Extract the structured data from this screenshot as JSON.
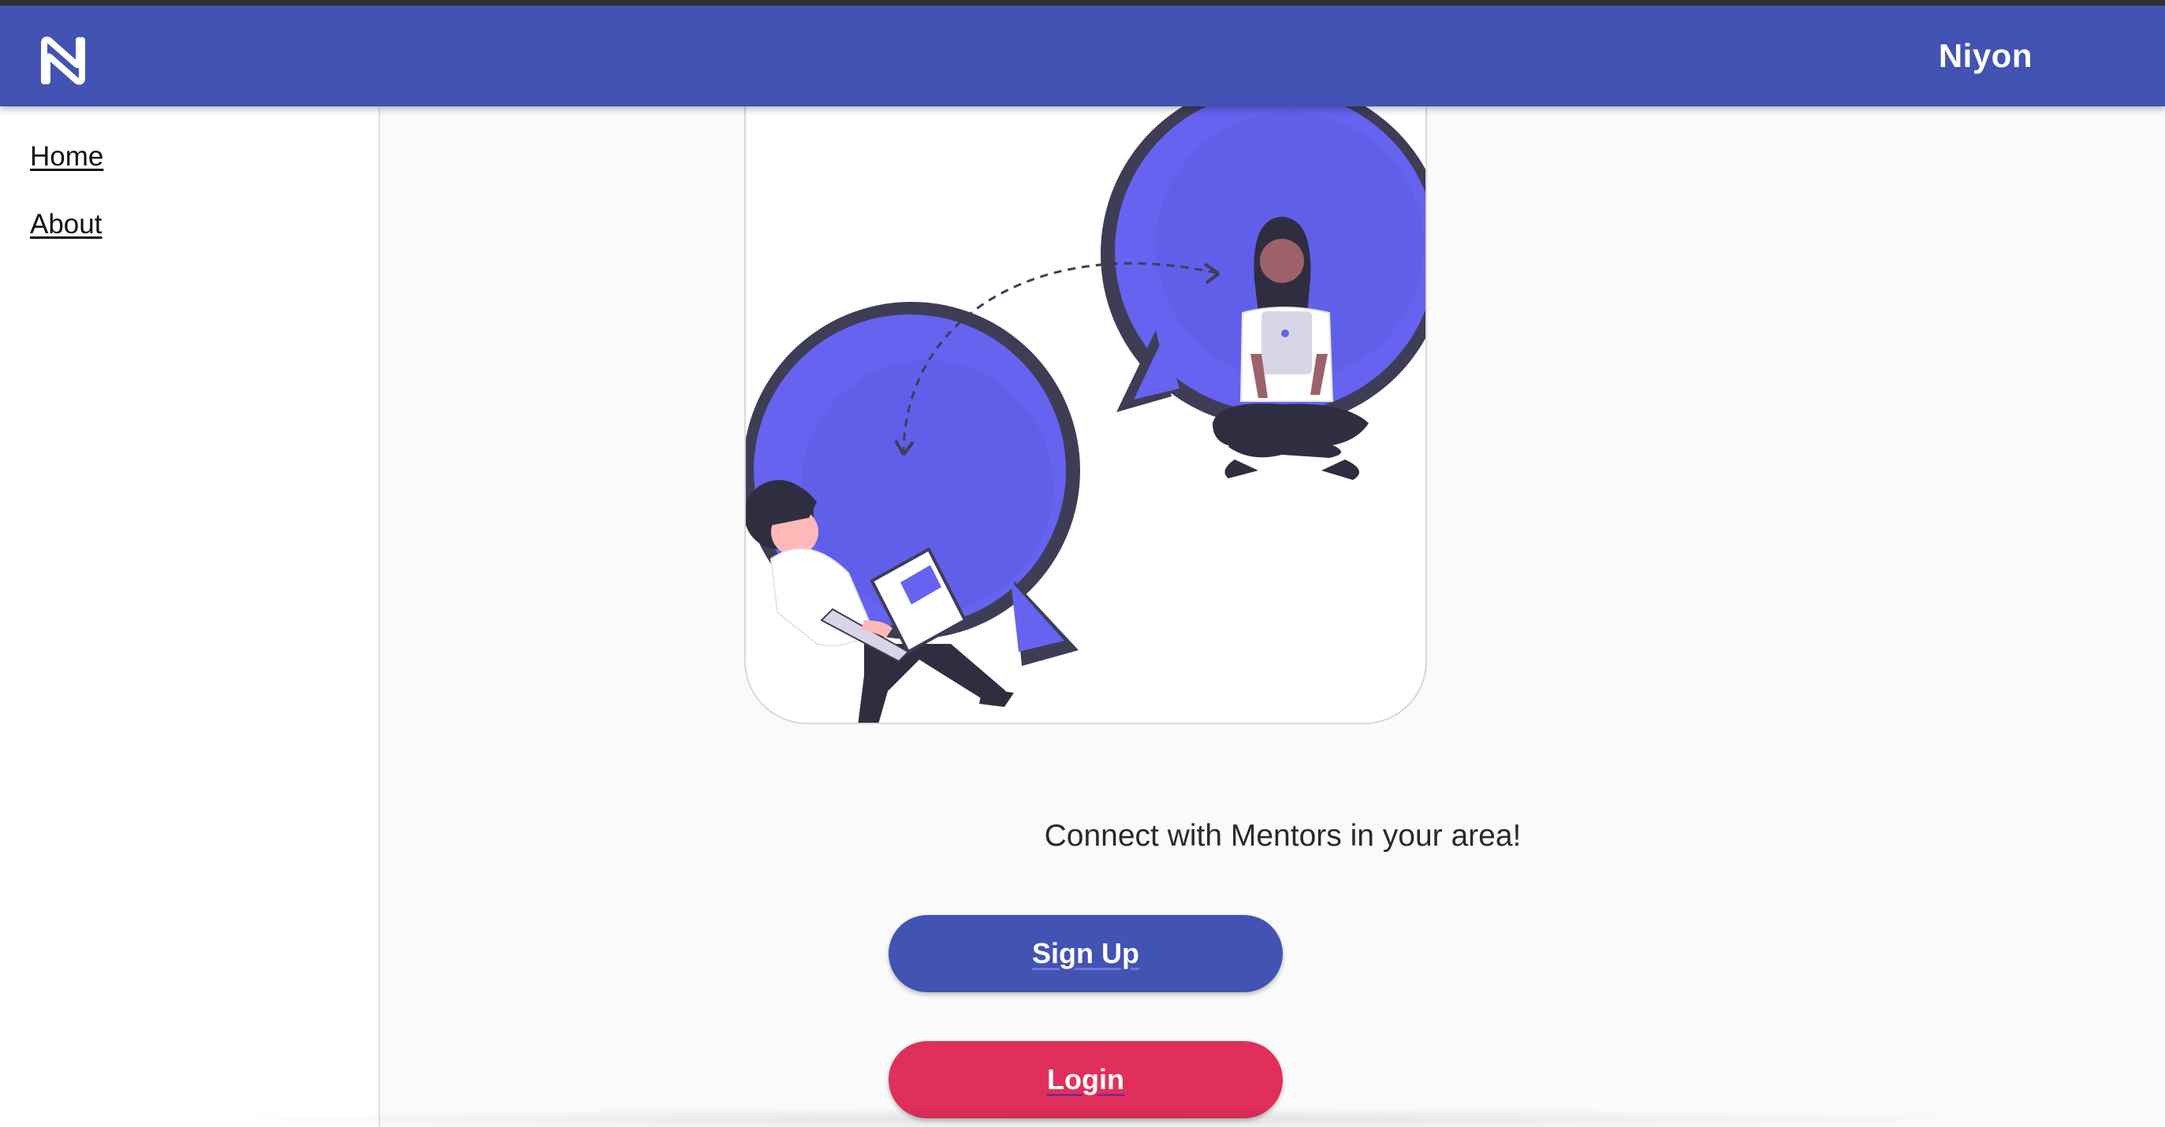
{
  "app": {
    "brand_name": "Niyon",
    "logo_icon": "niyon-n-logo-icon",
    "toolbar_color": "#4353b3"
  },
  "sidebar": {
    "items": [
      {
        "label": "Home"
      },
      {
        "label": "About"
      }
    ]
  },
  "main": {
    "hero_illustration": "mentor-chat-illustration",
    "tagline": "Connect with Mentors in your area!",
    "signup_label": "Sign Up",
    "login_label": "Login",
    "signup_color": "#4353b3",
    "login_color": "#e12f5b",
    "illustration_accent": "#6563f0"
  }
}
